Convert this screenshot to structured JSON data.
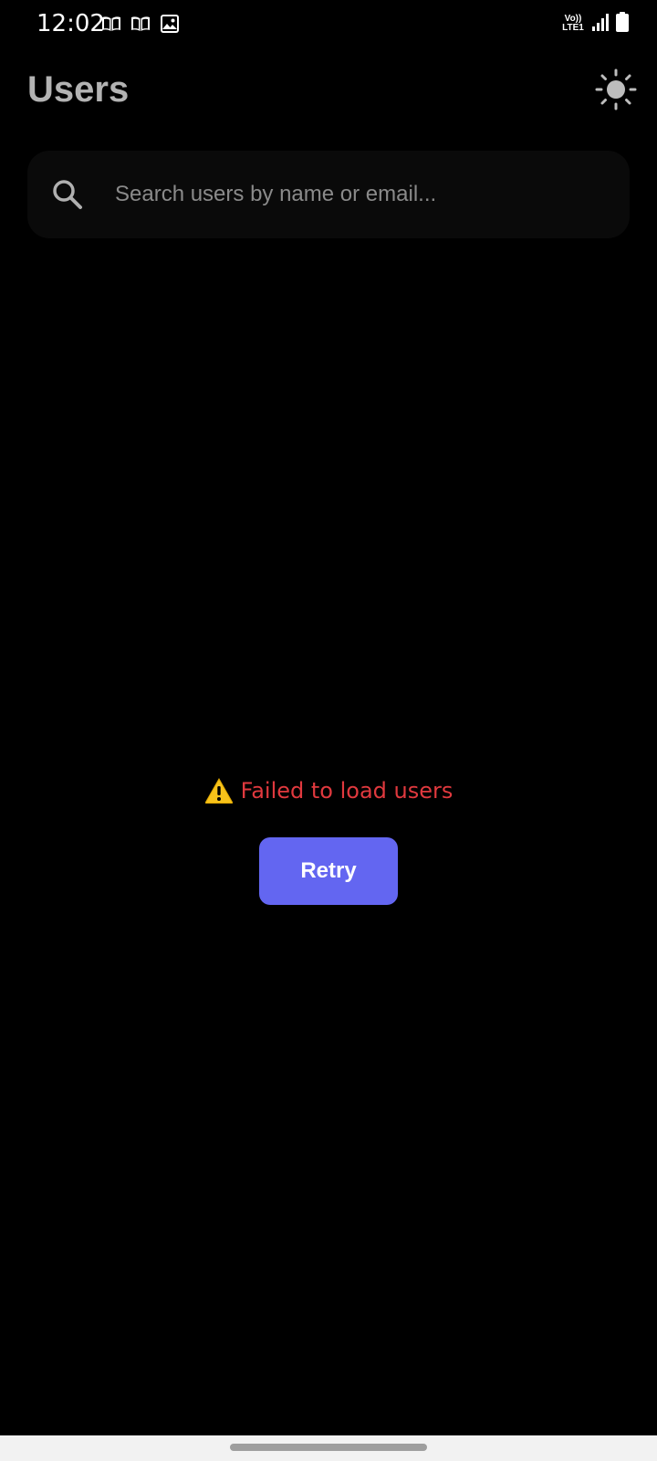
{
  "status_bar": {
    "time": "12:02",
    "network_label_top": "Vo))",
    "network_label_bottom": "LTE1",
    "left_icons": [
      "book-icon",
      "book-icon",
      "image-icon"
    ],
    "right_icons": [
      "signal-icon",
      "battery-icon"
    ]
  },
  "header": {
    "title": "Users",
    "theme_toggle_icon": "sun-icon"
  },
  "search": {
    "placeholder": "Search users by name or email...",
    "value": "",
    "icon": "search-icon"
  },
  "error": {
    "icon": "warning-icon",
    "message": "Failed to load users",
    "retry_label": "Retry"
  },
  "colors": {
    "background": "#000000",
    "title": "#b3b3b3",
    "error_text": "#e0393e",
    "accent": "#6366f1",
    "search_background": "#0a0a0a"
  }
}
